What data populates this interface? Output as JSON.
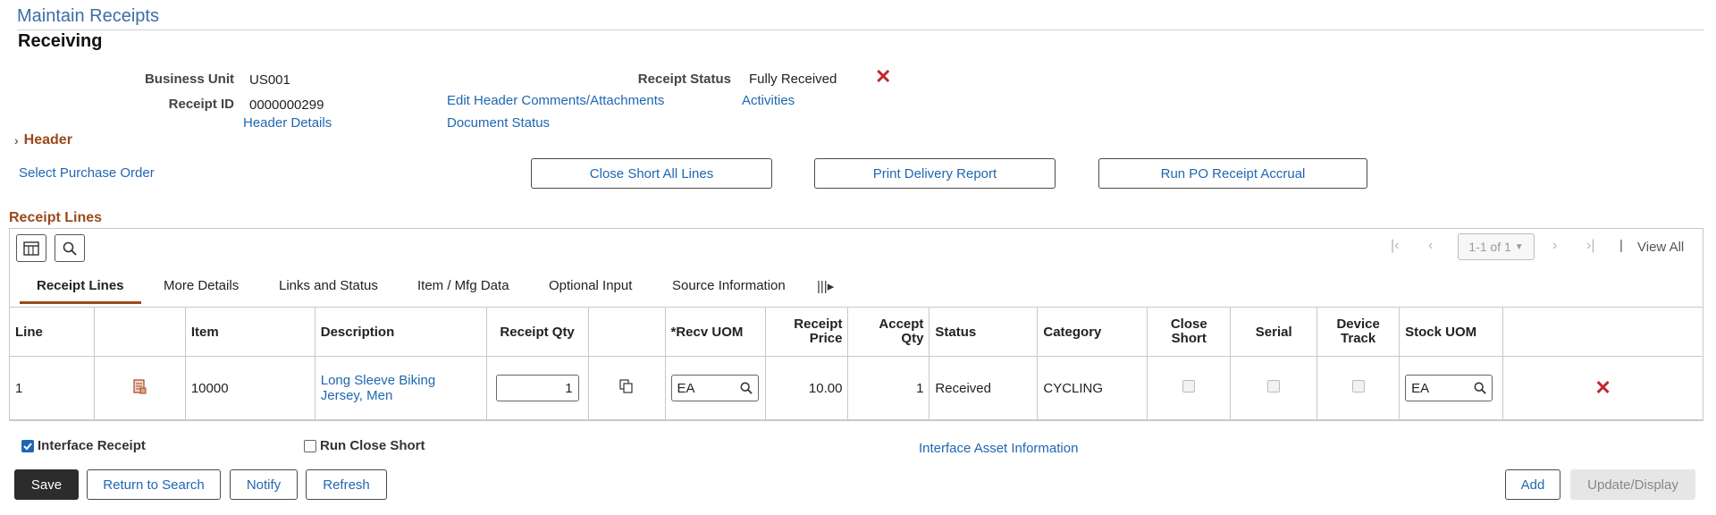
{
  "page": {
    "title": "Maintain Receipts",
    "subtitle": "Receiving"
  },
  "header_fields": {
    "business_unit_label": "Business Unit",
    "business_unit_value": "US001",
    "receipt_id_label": "Receipt ID",
    "receipt_id_value": "0000000299",
    "receipt_status_label": "Receipt Status",
    "receipt_status_value": "Fully Received",
    "links": {
      "header_details": "Header Details",
      "edit_header_comments": "Edit Header Comments/Attachments",
      "document_status": "Document Status",
      "activities": "Activities"
    }
  },
  "header_section": {
    "label": "Header"
  },
  "actions": {
    "select_po": "Select Purchase Order",
    "close_short_all": "Close Short All Lines",
    "print_delivery": "Print Delivery Report",
    "run_accrual": "Run PO Receipt Accrual"
  },
  "receipt_lines": {
    "section_title": "Receipt Lines",
    "pager": {
      "range": "1-1 of 1",
      "view_all": "View All"
    },
    "tabs": [
      {
        "label": "Receipt Lines",
        "active": true
      },
      {
        "label": "More Details"
      },
      {
        "label": "Links and Status"
      },
      {
        "label": "Item / Mfg Data"
      },
      {
        "label": "Optional Input"
      },
      {
        "label": "Source Information"
      }
    ],
    "columns": {
      "line": "Line",
      "item": "Item",
      "description": "Description",
      "receipt_qty": "Receipt Qty",
      "recv_uom": "*Recv UOM",
      "receipt_price_1": "Receipt",
      "receipt_price_2": "Price",
      "accept_qty_1": "Accept",
      "accept_qty_2": "Qty",
      "status": "Status",
      "category": "Category",
      "close_short_1": "Close",
      "close_short_2": "Short",
      "serial": "Serial",
      "device_track_1": "Device",
      "device_track_2": "Track",
      "stock_uom": "Stock UOM"
    },
    "rows": [
      {
        "line": "1",
        "item": "10000",
        "description": "Long Sleeve Biking Jersey, Men",
        "receipt_qty": "1",
        "recv_uom": "EA",
        "receipt_price": "10.00",
        "accept_qty": "1",
        "status": "Received",
        "category": "CYCLING",
        "stock_uom": "EA"
      }
    ]
  },
  "footer": {
    "interface_receipt": "Interface Receipt",
    "run_close_short": "Run Close Short",
    "interface_asset": "Interface Asset Information",
    "save": "Save",
    "return_to_search": "Return to Search",
    "notify": "Notify",
    "refresh": "Refresh",
    "add": "Add",
    "update_display": "Update/Display"
  },
  "colors": {
    "link": "#1f67b1",
    "section_heading": "#9a4a1c",
    "delete_x": "#c0282d",
    "title": "#3b6ea5"
  }
}
